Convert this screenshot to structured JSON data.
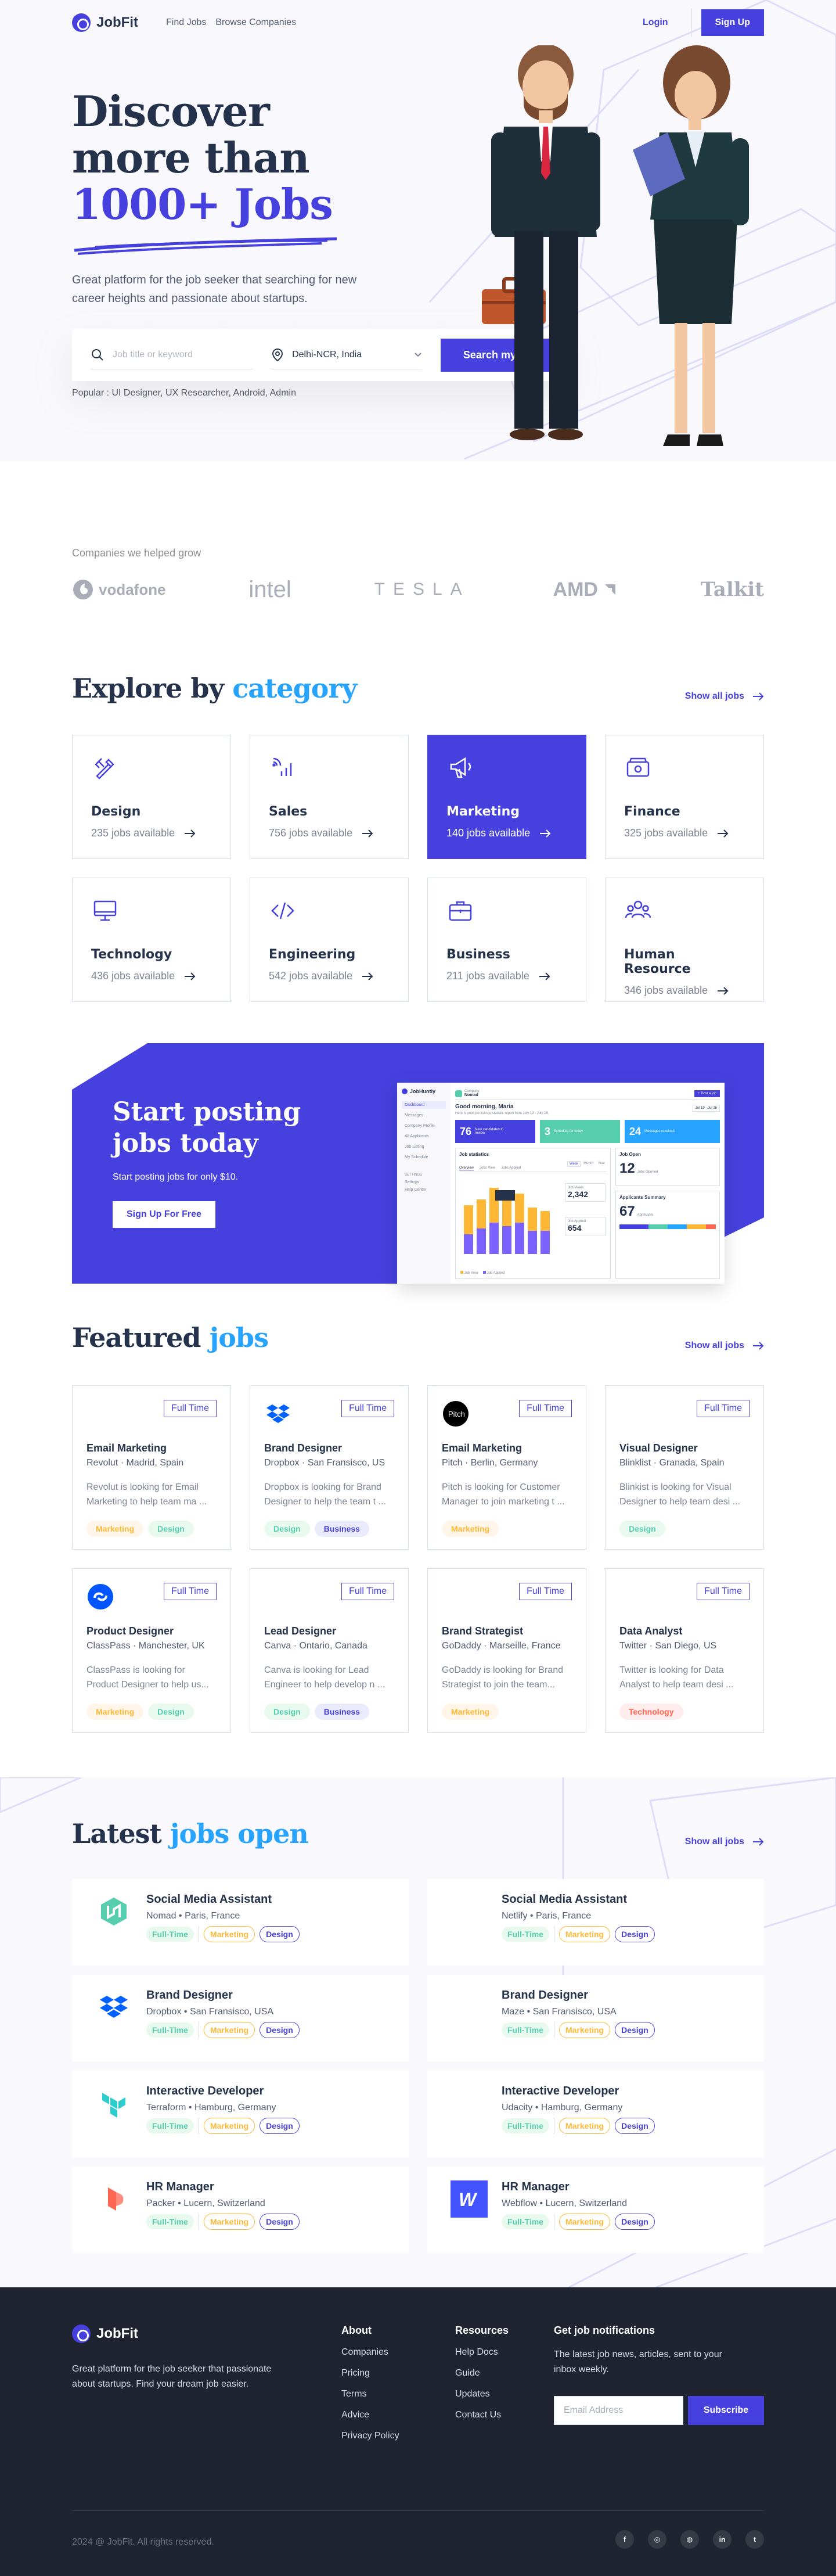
{
  "nav": {
    "brand": "JobFit",
    "links": [
      "Find Jobs",
      "Browse Companies"
    ],
    "login": "Login",
    "signup": "Sign Up"
  },
  "hero": {
    "title_line1": "Discover",
    "title_line2": "more than",
    "title_accent": "1000+ Jobs",
    "subtitle": "Great platform for the job seeker that searching for new career heights and passionate about startups.",
    "search_placeholder": "Job title or keyword",
    "location": "Delhi-NCR, India",
    "search_button": "Search my job",
    "popular": "Popular : UI Designer, UX Researcher, Android, Admin"
  },
  "companies": {
    "label": "Companies we helped grow",
    "logos": [
      "vodafone",
      "intel",
      "TESLA",
      "AMD",
      "Talkit"
    ]
  },
  "categories": {
    "title": "Explore by",
    "title_accent": "category",
    "show_all": "Show all jobs",
    "items": [
      {
        "name": "Design",
        "count": "235 jobs available",
        "icon": "design-icon"
      },
      {
        "name": "Sales",
        "count": "756 jobs available",
        "icon": "sales-icon"
      },
      {
        "name": "Marketing",
        "count": "140 jobs available",
        "icon": "megaphone-icon"
      },
      {
        "name": "Finance",
        "count": "325 jobs available",
        "icon": "finance-icon"
      },
      {
        "name": "Technology",
        "count": "436 jobs available",
        "icon": "monitor-icon"
      },
      {
        "name": "Engineering",
        "count": "542 jobs available",
        "icon": "code-icon"
      },
      {
        "name": "Business",
        "count": "211 jobs available",
        "icon": "briefcase-icon"
      },
      {
        "name": "Human Resource",
        "count": "346 jobs available",
        "icon": "people-icon"
      }
    ]
  },
  "cta": {
    "title": "Start posting jobs today",
    "subtitle": "Start posting jobs for only $10.",
    "button": "Sign Up For Free",
    "dashboard": {
      "brand": "JobHuntly",
      "company_label": "Company",
      "company": "Nomad",
      "post_button": "+ Post a job",
      "greeting": "Good morning, Maria",
      "greeting_sub": "Here is your job listings statistic report from July 19 - July 25.",
      "date_range": "Jul 19 - Jul 25",
      "menu": [
        "Dashboard",
        "Messages",
        "Company Profile",
        "All Applicants",
        "Job Listing",
        "My Schedule"
      ],
      "settings_label": "SETTINGS",
      "settings": [
        "Settings",
        "Help Center"
      ],
      "stats": [
        {
          "value": "76",
          "label": "New candidates to review"
        },
        {
          "value": "3",
          "label": "Schedule for today"
        },
        {
          "value": "24",
          "label": "Messages received"
        }
      ],
      "stats_title": "Job statistics",
      "tabs": [
        "Overview",
        "Jobs View",
        "Jobs Applied"
      ],
      "periods": [
        "Week",
        "Month",
        "Year"
      ],
      "job_views_label": "Job Views",
      "job_views": "2,342",
      "job_applied_label": "Job Applied",
      "job_applied": "654",
      "job_open_label": "Job Open",
      "job_open": "12",
      "job_open_sub": "Jobs Opened",
      "applicants_label": "Applicants Summary",
      "applicants": "67",
      "applicants_sub": "Applicants",
      "legend": [
        "Job View",
        "Job Applied"
      ]
    }
  },
  "featured": {
    "title": "Featured",
    "title_accent": "jobs",
    "show_all": "Show all jobs",
    "jobs": [
      {
        "title": "Email Marketing",
        "company": "Revolut",
        "location": "Madrid, Spain",
        "type": "Full Time",
        "desc": "Revolut is looking for Email Marketing to help team ma ...",
        "tags": [
          "Marketing",
          "Design"
        ],
        "logo": "revolut-logo"
      },
      {
        "title": "Brand Designer",
        "company": "Dropbox",
        "location": "San Fransisco, US",
        "type": "Full Time",
        "desc": "Dropbox is looking for Brand Designer to help the team t ...",
        "tags": [
          "Design",
          "Business"
        ],
        "logo": "dropbox-logo"
      },
      {
        "title": "Email Marketing",
        "company": "Pitch",
        "location": "Berlin, Germany",
        "type": "Full Time",
        "desc": "Pitch is looking for Customer Manager to join marketing t ...",
        "tags": [
          "Marketing"
        ],
        "logo": "pitch-logo"
      },
      {
        "title": "Visual Designer",
        "company": "Blinklist",
        "location": "Granada, Spain",
        "type": "Full Time",
        "desc": "Blinkist is looking for Visual Designer to help team desi ...",
        "tags": [
          "Design"
        ],
        "logo": "blinkist-logo"
      },
      {
        "title": "Product Designer",
        "company": "ClassPass",
        "location": "Manchester, UK",
        "type": "Full Time",
        "desc": "ClassPass is looking for Product Designer to help us...",
        "tags": [
          "Marketing",
          "Design"
        ],
        "logo": "classpass-logo"
      },
      {
        "title": "Lead Designer",
        "company": "Canva",
        "location": "Ontario, Canada",
        "type": "Full Time",
        "desc": "Canva is looking for Lead Engineer to help develop n ...",
        "tags": [
          "Design",
          "Business"
        ],
        "logo": "canva-logo"
      },
      {
        "title": "Brand Strategist",
        "company": "GoDaddy",
        "location": "Marseille, France",
        "type": "Full Time",
        "desc": "GoDaddy is looking for Brand Strategist to join the team...",
        "tags": [
          "Marketing"
        ],
        "logo": "godaddy-logo"
      },
      {
        "title": "Data Analyst",
        "company": "Twitter",
        "location": "San Diego, US",
        "type": "Full Time",
        "desc": "Twitter is looking for Data Analyst to help team desi ...",
        "tags": [
          "Technology"
        ],
        "logo": "twitter-logo"
      }
    ]
  },
  "latest": {
    "title": "Latest",
    "title_accent": "jobs open",
    "show_all": "Show all jobs",
    "tags": [
      "Full-Time",
      "Marketing",
      "Design"
    ],
    "jobs": [
      {
        "title": "Social Media Assistant",
        "company": "Nomad",
        "location": "Paris, France",
        "logo": "nomad-logo"
      },
      {
        "title": "Social Media Assistant",
        "company": "Netlify",
        "location": "Paris, France",
        "logo": "netlify-logo"
      },
      {
        "title": "Brand Designer",
        "company": "Dropbox",
        "location": "San Fransisco, USA",
        "logo": "dropbox-logo"
      },
      {
        "title": "Brand Designer",
        "company": "Maze",
        "location": "San Fransisco, USA",
        "logo": "maze-logo"
      },
      {
        "title": "Interactive Developer",
        "company": "Terraform",
        "location": "Hamburg, Germany",
        "logo": "terraform-logo"
      },
      {
        "title": "Interactive Developer",
        "company": "Udacity",
        "location": "Hamburg, Germany",
        "logo": "udacity-logo"
      },
      {
        "title": "HR Manager",
        "company": "Packer",
        "location": "Lucern, Switzerland",
        "logo": "packer-logo"
      },
      {
        "title": "HR Manager",
        "company": "Webflow",
        "location": "Lucern, Switzerland",
        "logo": "webflow-logo"
      }
    ]
  },
  "footer": {
    "brand": "JobFit",
    "desc": "Great platform for the job seeker that passionate about startups. Find your dream job easier.",
    "about_title": "About",
    "about": [
      "Companies",
      "Pricing",
      "Terms",
      "Advice",
      "Privacy Policy"
    ],
    "resources_title": "Resources",
    "resources": [
      "Help Docs",
      "Guide",
      "Updates",
      "Contact Us"
    ],
    "notify_title": "Get job notifications",
    "notify_desc": "The latest job news, articles, sent to your inbox weekly.",
    "email_placeholder": "Email Address",
    "subscribe": "Subscribe",
    "copyright": "2024 @ JobFit. All rights reserved.",
    "social": [
      "f",
      "◎",
      "◍",
      "in",
      "t"
    ]
  },
  "colors": {
    "primary": "#4640DE",
    "accent_blue": "#26A4FF",
    "dark": "#25324B",
    "footer": "#202430"
  }
}
